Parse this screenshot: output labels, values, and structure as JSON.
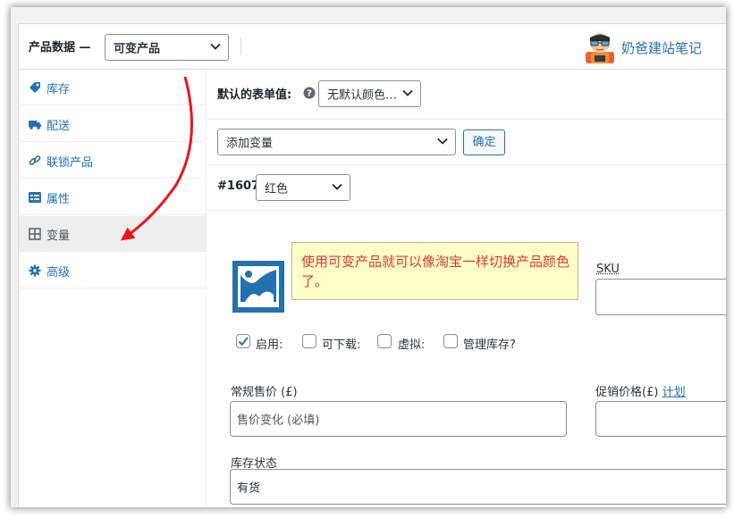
{
  "header": {
    "title": "产品数据 —",
    "product_type": "可变产品",
    "brand_text": "奶爸建站笔记"
  },
  "nav": {
    "items": [
      {
        "label": "库存",
        "icon": "tag-icon"
      },
      {
        "label": "配送",
        "icon": "truck-icon"
      },
      {
        "label": "联锁产品",
        "icon": "link-icon"
      },
      {
        "label": "属性",
        "icon": "list-icon"
      },
      {
        "label": "变量",
        "icon": "grid-icon",
        "active": true
      },
      {
        "label": "高级",
        "icon": "gear-icon"
      }
    ]
  },
  "main": {
    "default_form_label": "默认的表单值:",
    "default_form_value": "无默认颜色…",
    "add_variation_value": "添加变量",
    "confirm_label": "确定",
    "variation_id": "#1607",
    "variation_color": "红色",
    "tooltip": "使用可变产品就可以像淘宝一样切换产品颜色了。",
    "sku_label": "SKU",
    "sku_value": "",
    "checkboxes": [
      {
        "label": "启用:",
        "checked": true
      },
      {
        "label": "可下载:",
        "checked": false
      },
      {
        "label": "虚拟:",
        "checked": false
      },
      {
        "label": "管理库存?",
        "checked": false
      }
    ],
    "regular_price_label": "常规售价 (£)",
    "regular_price_placeholder": "售价变化 (必填)",
    "sale_price_label": "促销价格(£)",
    "sale_schedule_link": "计划",
    "stock_status_label": "库存状态",
    "stock_status_value": "有货"
  },
  "colors": {
    "link": "#2271b1",
    "tooltip_bg": "#ffffc9",
    "tooltip_text": "#d9383a",
    "arrow": "#e8161b"
  }
}
